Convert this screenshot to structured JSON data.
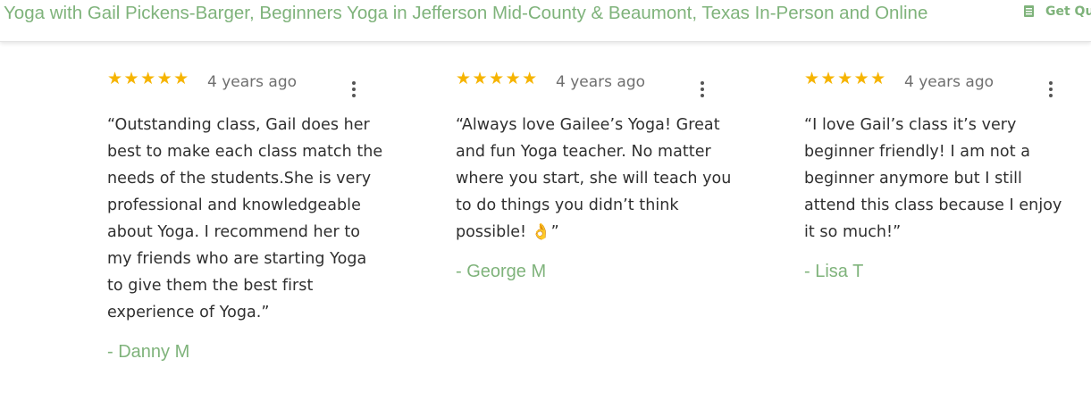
{
  "header": {
    "site_title": "Yoga with Gail Pickens-Barger, Beginners Yoga in Jefferson Mid-County & Beaumont, Texas In-Person and Online",
    "cta_label": "Get Quote",
    "cta_icon": "form-icon"
  },
  "colors": {
    "accent_green": "#7fb37b",
    "star_gold": "#f6b400",
    "body_text": "#2f2f2f",
    "meta_grey": "#6f6f6f"
  },
  "reviews": [
    {
      "rating": 5,
      "stars": "★★★★★",
      "date": "4 years ago",
      "text": "“Outstanding class, Gail does her best to make each class match the needs of the students.She is very professional and knowledgeable about Yoga. I recommend her to my friends who are starting Yoga to give them the best first experience of Yoga.”",
      "author": "- Danny M"
    },
    {
      "rating": 5,
      "stars": "★★★★★",
      "date": "4 years ago",
      "text": "“Always love Gailee’s Yoga! Great and fun Yoga teacher. No matter where you start, she will teach you to do things you didn’t think possible! 👌”",
      "author": "- George M"
    },
    {
      "rating": 5,
      "stars": "★★★★★",
      "date": "4 years ago",
      "text": "“I love Gail’s class it’s very beginner friendly! I am not a beginner anymore but I still attend this class because I enjoy it so much!”",
      "author": "- Lisa T"
    }
  ]
}
